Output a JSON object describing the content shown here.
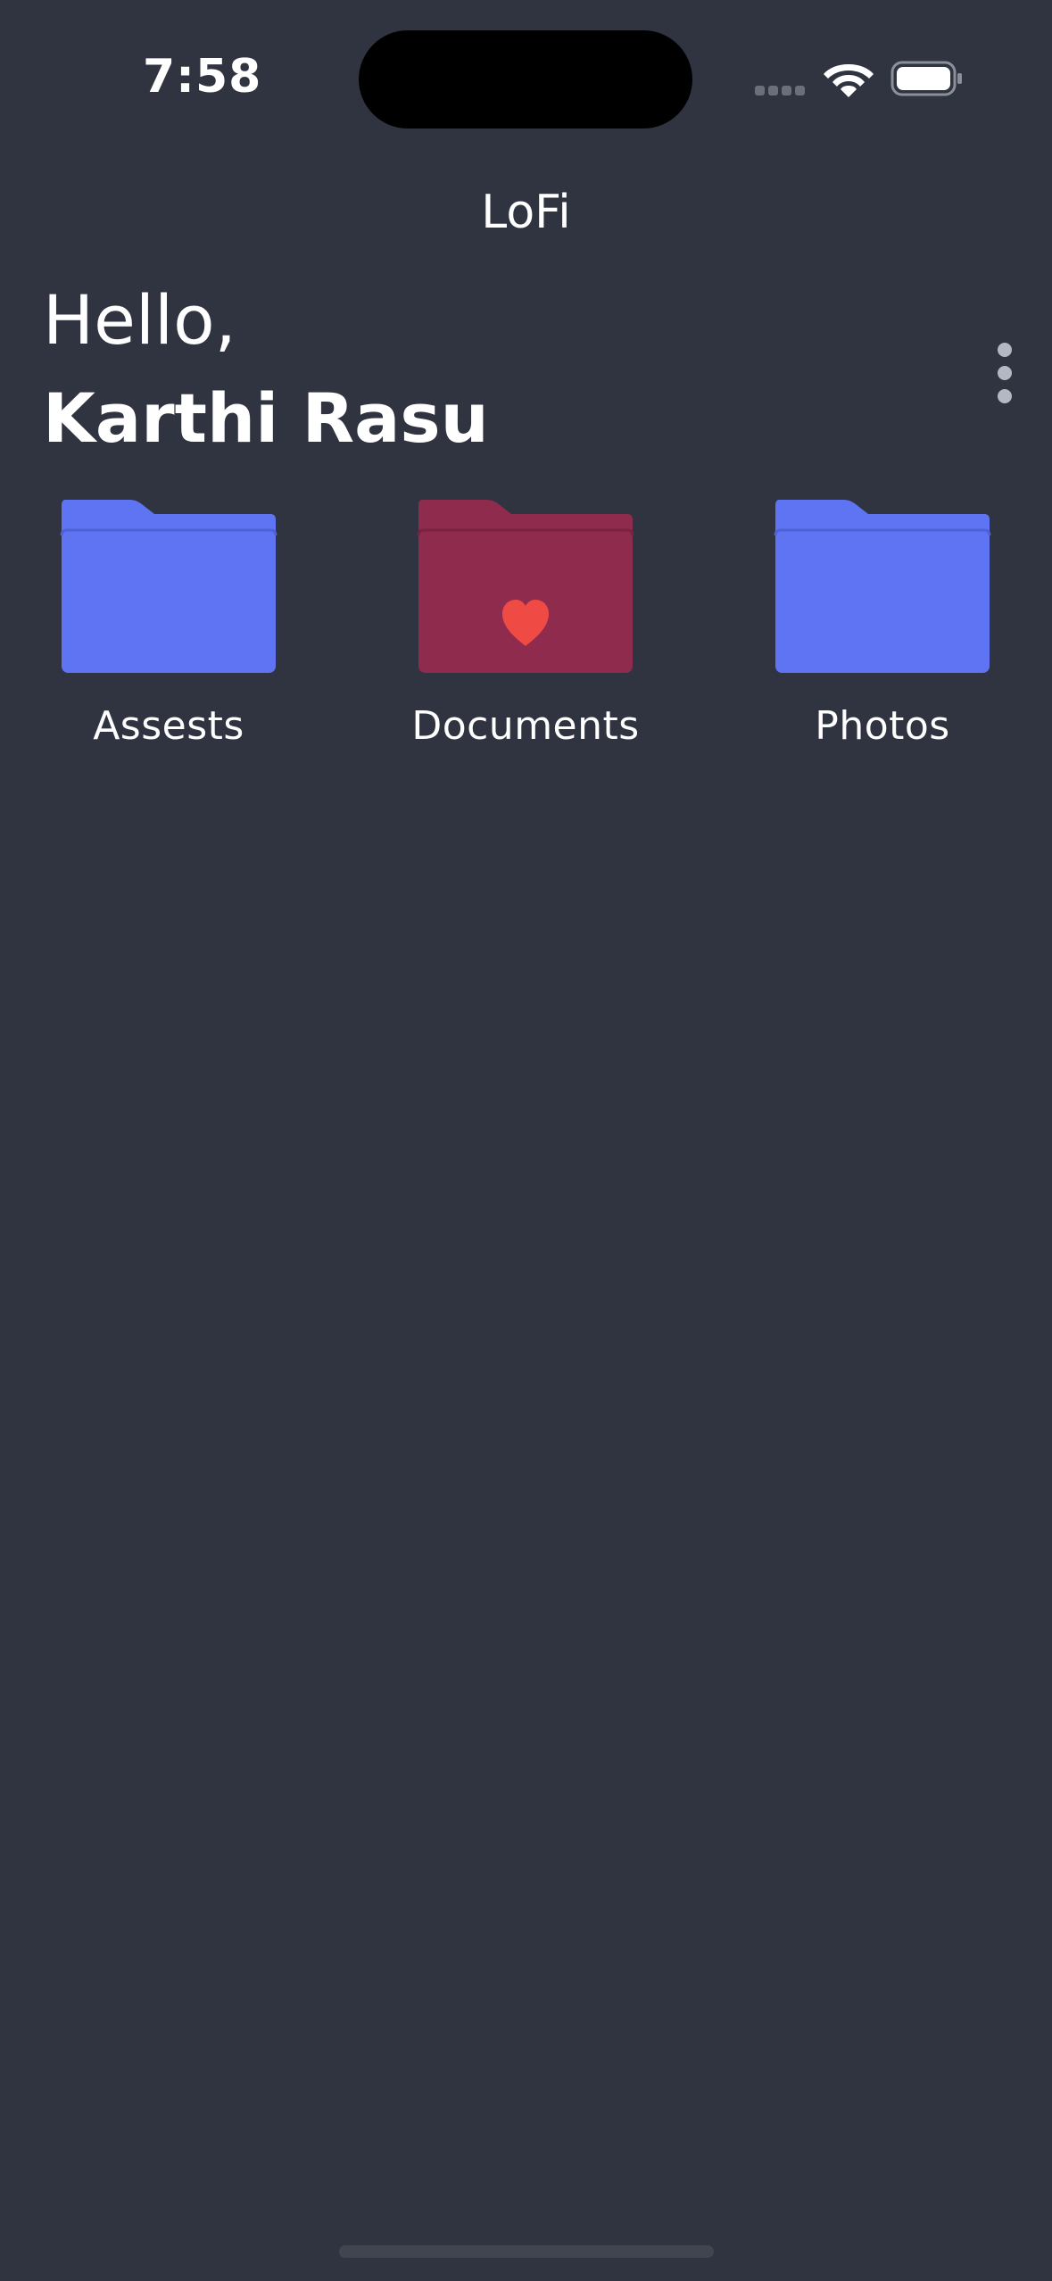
{
  "status_bar": {
    "time": "7:58"
  },
  "header": {
    "title": "LoFi"
  },
  "greeting": {
    "hello": "Hello,",
    "name": "Karthi Rasu"
  },
  "folders": [
    {
      "label": "Assests",
      "color": "#5f74f2",
      "badge": null
    },
    {
      "label": "Documents",
      "color": "#8f2b4d",
      "badge": "heart-icon"
    },
    {
      "label": "Photos",
      "color": "#5f74f2",
      "badge": null
    }
  ],
  "colors": {
    "background": "#2f3440",
    "folder_blue": "#5f74f2",
    "folder_red": "#8f2b4d",
    "heart": "#f04a45"
  }
}
